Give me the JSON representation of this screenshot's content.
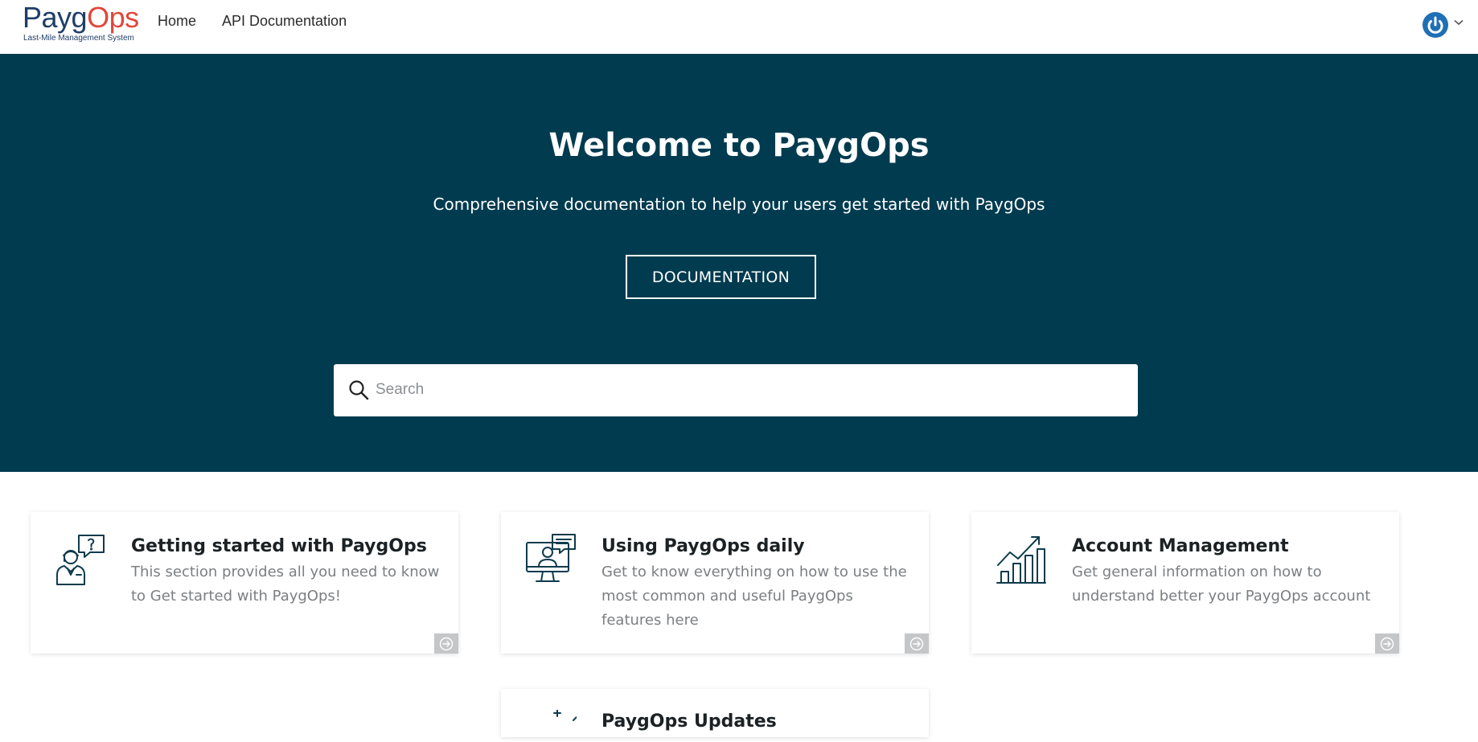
{
  "brand": {
    "name_part1": "Payg",
    "name_part2": "Ops",
    "tagline": "Last-Mile Management System",
    "colors": {
      "navy": "#1e3e68",
      "red": "#e2463a",
      "hero_bg": "#003b4f",
      "user_icon": "#1f6fb5"
    }
  },
  "nav": {
    "home": "Home",
    "api_docs": "API Documentation",
    "user_menu_icon": "power-icon"
  },
  "hero": {
    "title": "Welcome to PaygOps",
    "subtitle": "Comprehensive documentation to help your users get started with PaygOps",
    "button": "DOCUMENTATION"
  },
  "search": {
    "placeholder": "Search",
    "value": ""
  },
  "cards": [
    {
      "icon": "support-agent-icon",
      "title": "Getting started with PaygOps",
      "description": "This section provides all you need to know to Get started with PaygOps!"
    },
    {
      "icon": "monitor-chat-icon",
      "title": "Using PaygOps daily",
      "description": "Get to know everything on how to use the most common and useful PaygOps features here"
    },
    {
      "icon": "growth-chart-icon",
      "title": "Account Management",
      "description": "Get general information on how to understand better your PaygOps account"
    },
    {
      "icon": "sparkle-icon",
      "title": "PaygOps Updates",
      "description": ""
    }
  ]
}
